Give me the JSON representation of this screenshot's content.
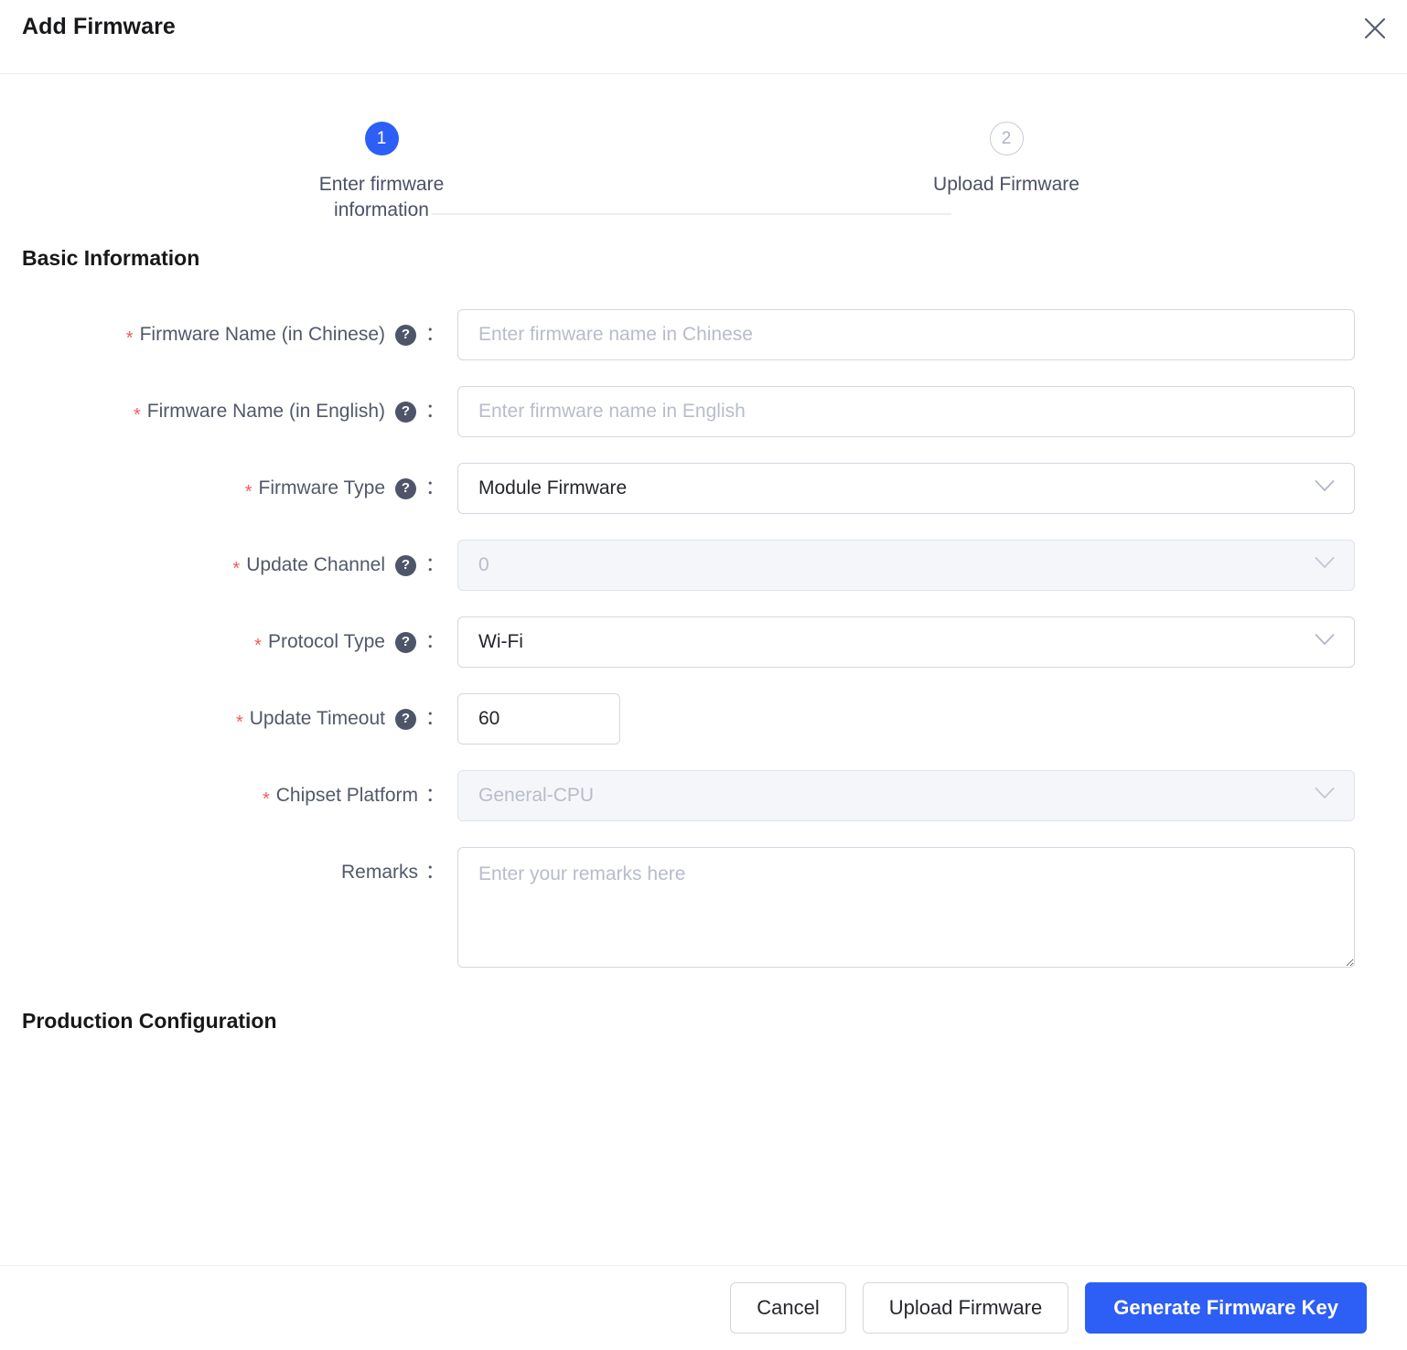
{
  "dialog": {
    "title": "Add Firmware",
    "close_icon": "close-icon"
  },
  "steps": {
    "items": [
      {
        "number": "1",
        "label": "Enter firmware information",
        "state": "active"
      },
      {
        "number": "2",
        "label": "Upload Firmware",
        "state": "inactive"
      }
    ]
  },
  "sections": {
    "basic_information": "Basic Information",
    "production_configuration": "Production Configuration"
  },
  "form": {
    "firmware_name_cn": {
      "label": "Firmware Name (in Chinese)",
      "required_mark": "*",
      "colon": "：",
      "help_glyph": "?",
      "placeholder": "Enter firmware name in Chinese",
      "value": ""
    },
    "firmware_name_en": {
      "label": "Firmware Name (in English)",
      "required_mark": "*",
      "colon": "：",
      "help_glyph": "?",
      "placeholder": "Enter firmware name in English",
      "value": ""
    },
    "firmware_type": {
      "label": "Firmware Type",
      "required_mark": "*",
      "colon": "：",
      "help_glyph": "?",
      "value": "Module Firmware"
    },
    "update_channel": {
      "label": "Update Channel",
      "required_mark": "*",
      "colon": "：",
      "help_glyph": "?",
      "value": "0",
      "disabled": true
    },
    "protocol_type": {
      "label": "Protocol Type",
      "required_mark": "*",
      "colon": "：",
      "help_glyph": "?",
      "value": "Wi-Fi"
    },
    "update_timeout": {
      "label": "Update Timeout",
      "required_mark": "*",
      "colon": "：",
      "help_glyph": "?",
      "value": "60"
    },
    "chipset_platform": {
      "label": "Chipset Platform",
      "required_mark": "*",
      "colon": "：",
      "value": "General-CPU",
      "disabled": true
    },
    "remarks": {
      "label": "Remarks",
      "colon": "：",
      "placeholder": "Enter your remarks here",
      "value": ""
    }
  },
  "footer": {
    "cancel_label": "Cancel",
    "upload_label": "Upload Firmware",
    "generate_label": "Generate Firmware Key"
  },
  "colors": {
    "accent_blue": "#2d5ef5",
    "required_red": "#f05b5b",
    "label_text": "#515869",
    "help_icon_bg": "#4e5569",
    "border": "#d3d7e0",
    "disabled_bg": "#f4f6fa"
  }
}
